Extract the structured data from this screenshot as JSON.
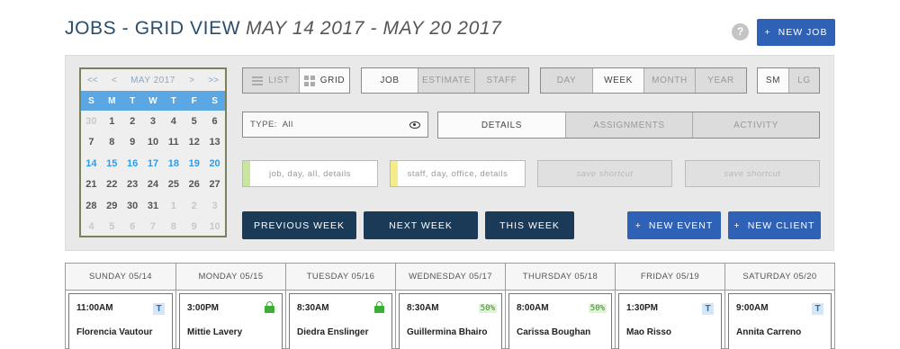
{
  "header": {
    "title": "JOBS - GRID VIEW",
    "range": "MAY 14 2017 - MAY 20 2017",
    "help": "?",
    "new_job_icon": "+",
    "new_job_label": "NEW JOB"
  },
  "calendar": {
    "prev_year": "<<",
    "prev_month": "<",
    "month": "MAY 2017",
    "next_month": ">",
    "next_year": ">>",
    "dow": [
      "S",
      "M",
      "T",
      "W",
      "T",
      "F",
      "S"
    ],
    "days": [
      [
        "30",
        "1",
        "2",
        "3",
        "4",
        "5",
        "6"
      ],
      [
        "7",
        "8",
        "9",
        "10",
        "11",
        "12",
        "13"
      ],
      [
        "14",
        "15",
        "16",
        "17",
        "18",
        "19",
        "20"
      ],
      [
        "21",
        "22",
        "23",
        "24",
        "25",
        "26",
        "27"
      ],
      [
        "28",
        "29",
        "30",
        "31",
        "1",
        "2",
        "3"
      ],
      [
        "4",
        "5",
        "6",
        "7",
        "8",
        "9",
        "10"
      ]
    ]
  },
  "view_toggle": {
    "list": "LIST",
    "grid": "GRID",
    "active": "grid"
  },
  "type_toggle": {
    "job": "JOB",
    "estimate": "ESTIMATE",
    "staff": "STAFF",
    "active": "job"
  },
  "period_toggle": {
    "day": "DAY",
    "week": "WEEK",
    "month": "MONTH",
    "year": "YEAR",
    "active": "week"
  },
  "size_toggle": {
    "sm": "SM",
    "lg": "LG",
    "active": "sm"
  },
  "filter": {
    "type_label": "TYPE:",
    "type_value": "All"
  },
  "detail_tabs": {
    "details": "DETAILS",
    "assignments": "ASSIGNMENTS",
    "activity": "ACTIVITY",
    "active": "details"
  },
  "search": {
    "job_placeholder": "job, day, all, details",
    "staff_placeholder": "staff, day, office, details",
    "shortcut1": "save shortcut",
    "shortcut2": "save shortcut"
  },
  "nav": {
    "previous": "PREVIOUS WEEK",
    "next": "NEXT WEEK",
    "this_week": "THIS WEEK",
    "new_event_icon": "+",
    "new_event": "NEW EVENT",
    "new_client_icon": "+",
    "new_client": "NEW CLIENT"
  },
  "colors": {
    "job_stripe": "#c8e6a0",
    "staff_stripe": "#f3ec8a"
  },
  "week": [
    {
      "header": "SUNDAY 05/14",
      "time": "11:00AM",
      "name": "Florencia Vautour",
      "badge": "T"
    },
    {
      "header": "MONDAY 05/15",
      "time": "3:00PM",
      "name": "Mittie Lavery",
      "badge": "lock"
    },
    {
      "header": "TUESDAY 05/16",
      "time": "8:30AM",
      "name": "Diedra Enslinger",
      "badge": "lock"
    },
    {
      "header": "WEDNESDAY 05/17",
      "time": "8:30AM",
      "name": "Guillermina Bhairo",
      "badge": "50%"
    },
    {
      "header": "THURSDAY 05/18",
      "time": "8:00AM",
      "name": "Carissa Boughan",
      "badge": "50%"
    },
    {
      "header": "FRIDAY 05/19",
      "time": "1:30PM",
      "name": "Mao Risso",
      "badge": "T"
    },
    {
      "header": "SATURDAY 05/20",
      "time": "9:00AM",
      "name": "Annita Carreno",
      "badge": "T"
    }
  ]
}
